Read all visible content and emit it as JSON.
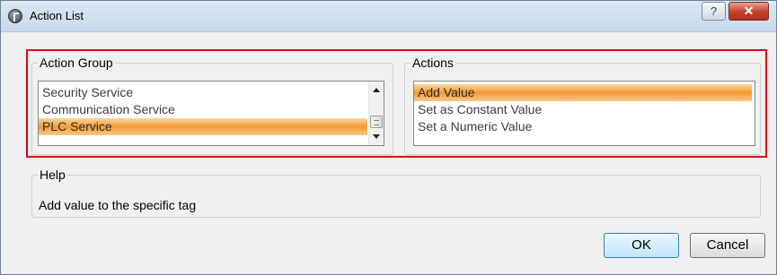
{
  "window": {
    "title": "Action List",
    "help_glyph": "?",
    "close_glyph": "✕"
  },
  "action_group": {
    "label": "Action Group",
    "items": [
      {
        "label": "Security Service"
      },
      {
        "label": "Communication Service"
      },
      {
        "label": "PLC Service"
      }
    ],
    "selected_index": 2
  },
  "actions": {
    "label": "Actions",
    "items": [
      {
        "label": "Add Value"
      },
      {
        "label": "Set as Constant Value"
      },
      {
        "label": "Set a Numeric Value"
      }
    ],
    "selected_index": 0
  },
  "help": {
    "label": "Help",
    "text": "Add value to the specific tag"
  },
  "buttons": {
    "ok": "OK",
    "cancel": "Cancel"
  },
  "colors": {
    "highlight": "#e2001a",
    "selection": "#f39a34"
  },
  "icons": {
    "app": "app-logo-icon",
    "help": "help-icon",
    "close": "close-icon"
  }
}
